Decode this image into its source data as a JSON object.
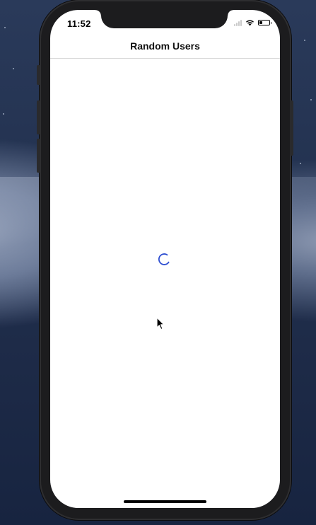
{
  "status_bar": {
    "time": "11:52",
    "wifi_icon": "wifi-icon",
    "battery_icon": "battery-icon",
    "battery_level": 0.3
  },
  "nav_bar": {
    "title": "Random Users"
  },
  "content": {
    "loading_icon": "activity-spinner-icon",
    "accent_color": "#2f4fd1"
  },
  "cursor_icon": "mouse-pointer-icon"
}
